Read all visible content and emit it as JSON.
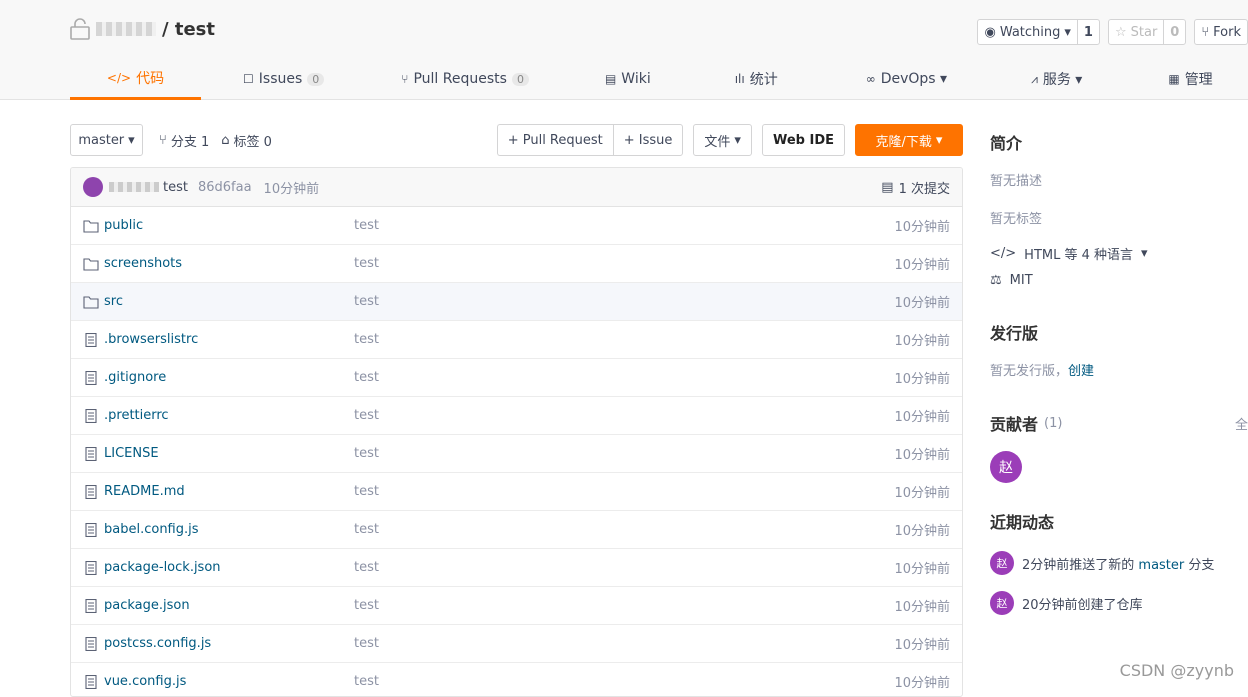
{
  "repo": {
    "name": "test"
  },
  "header_buttons": {
    "watching": {
      "label": "Watching",
      "count": "1"
    },
    "star": {
      "label": "Star",
      "count": "0"
    },
    "fork": {
      "label": "Fork"
    }
  },
  "tabs": [
    {
      "icon": "</>",
      "label": "代码",
      "active": true
    },
    {
      "icon": "☐",
      "label": "Issues",
      "badge": "0"
    },
    {
      "icon": "⑂",
      "label": "Pull Requests",
      "badge": "0"
    },
    {
      "icon": "▤",
      "label": "Wiki"
    },
    {
      "icon": "ılı",
      "label": "统计"
    },
    {
      "icon": "∞",
      "label": "DevOps ▾"
    },
    {
      "icon": "⩘",
      "label": "服务 ▾"
    },
    {
      "icon": "▦",
      "label": "管理"
    }
  ],
  "toolbar": {
    "branch": "master",
    "branches_label": "分支 1",
    "tags_label": "标签 0",
    "pull_request": "+ Pull Request",
    "issue": "+ Issue",
    "files": "文件",
    "web_ide": "Web IDE",
    "clone": "克隆/下载"
  },
  "commit": {
    "message": "test",
    "sha": "86d6faa",
    "time": "10分钟前",
    "count": "1 次提交"
  },
  "files": [
    {
      "name": "public",
      "type": "dir",
      "message": "test",
      "time": "10分钟前"
    },
    {
      "name": "screenshots",
      "type": "dir",
      "message": "test",
      "time": "10分钟前"
    },
    {
      "name": "src",
      "type": "dir",
      "message": "test",
      "time": "10分钟前"
    },
    {
      "name": ".browserslistrc",
      "type": "file",
      "message": "test",
      "time": "10分钟前"
    },
    {
      "name": ".gitignore",
      "type": "file",
      "message": "test",
      "time": "10分钟前"
    },
    {
      "name": ".prettierrc",
      "type": "file",
      "message": "test",
      "time": "10分钟前"
    },
    {
      "name": "LICENSE",
      "type": "file",
      "message": "test",
      "time": "10分钟前"
    },
    {
      "name": "README.md",
      "type": "file",
      "message": "test",
      "time": "10分钟前"
    },
    {
      "name": "babel.config.js",
      "type": "file",
      "message": "test",
      "time": "10分钟前"
    },
    {
      "name": "package-lock.json",
      "type": "file",
      "message": "test",
      "time": "10分钟前"
    },
    {
      "name": "package.json",
      "type": "file",
      "message": "test",
      "time": "10分钟前"
    },
    {
      "name": "postcss.config.js",
      "type": "file",
      "message": "test",
      "time": "10分钟前"
    },
    {
      "name": "vue.config.js",
      "type": "file",
      "message": "test",
      "time": "10分钟前"
    }
  ],
  "sidebar": {
    "intro_title": "简介",
    "no_desc": "暂无描述",
    "no_tags": "暂无标签",
    "languages": "HTML 等 4 种语言",
    "license": "MIT",
    "release_title": "发行版",
    "no_release": "暂无发行版，",
    "create": "创建",
    "contrib_title": "贡献者",
    "contrib_count": "(1)",
    "contrib_all": "全",
    "avatar_char": "赵",
    "activity_title": "近期动态",
    "activity_1_prefix": "2分钟前推送了新的 ",
    "activity_1_branch": "master",
    "activity_1_suffix": " 分支",
    "activity_2": "20分钟前创建了仓库"
  },
  "watermark": "CSDN @zyynb",
  "colors": {
    "accent": "#fe7300",
    "link": "#005980",
    "avatar": "#9b3db8"
  }
}
